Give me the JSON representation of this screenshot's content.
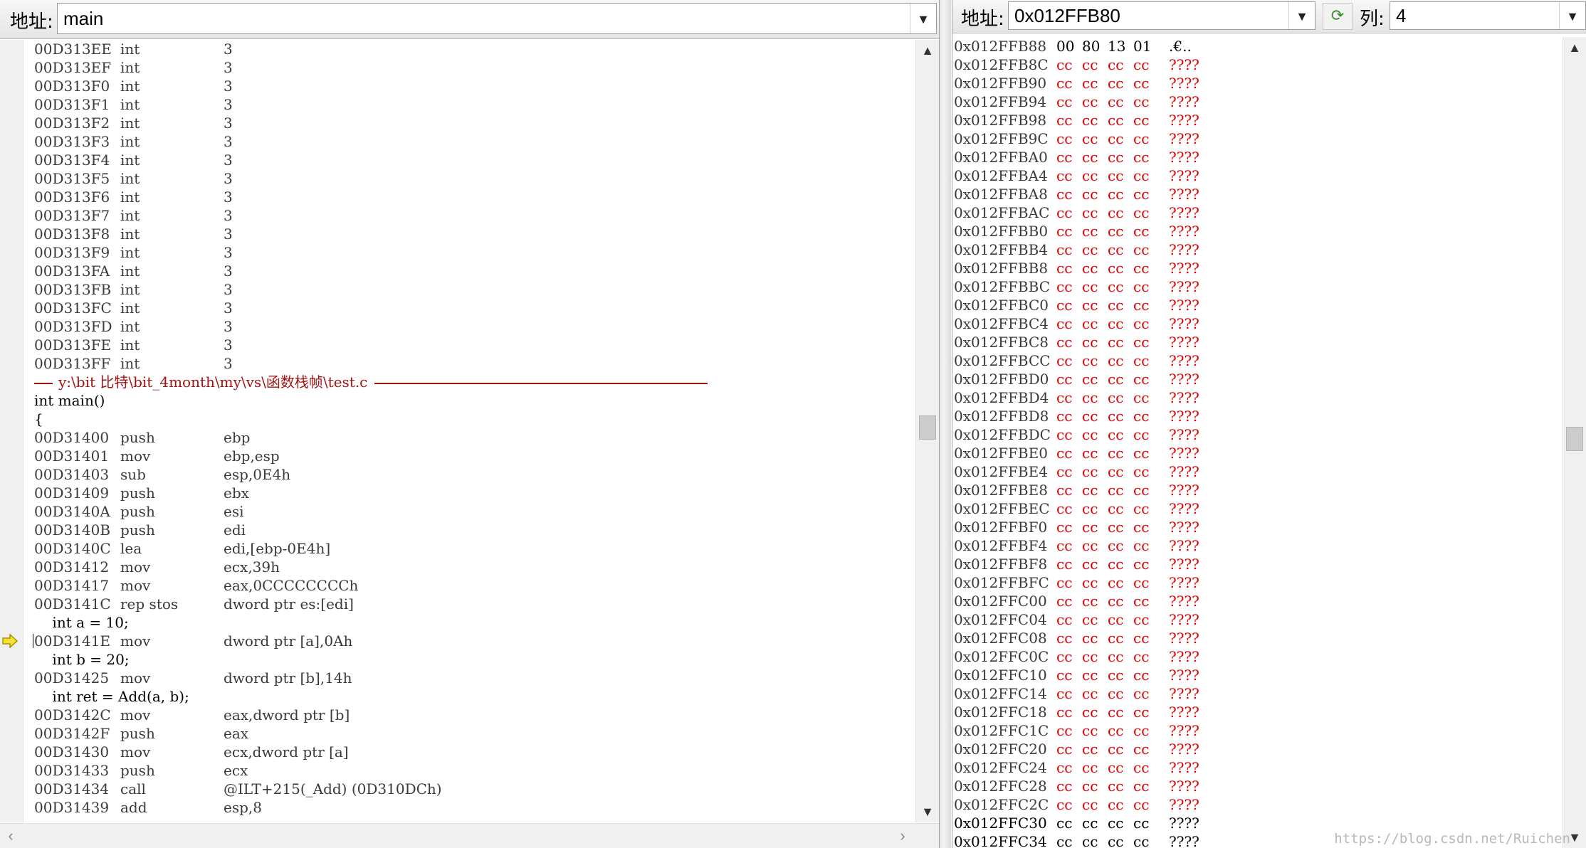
{
  "disasm": {
    "address_label": "地址:",
    "address_value": "main",
    "rows": [
      {
        "kind": "asm",
        "addr": "00D313EE",
        "op": "int",
        "arg": "3"
      },
      {
        "kind": "asm",
        "addr": "00D313EF",
        "op": "int",
        "arg": "3"
      },
      {
        "kind": "asm",
        "addr": "00D313F0",
        "op": "int",
        "arg": "3"
      },
      {
        "kind": "asm",
        "addr": "00D313F1",
        "op": "int",
        "arg": "3"
      },
      {
        "kind": "asm",
        "addr": "00D313F2",
        "op": "int",
        "arg": "3"
      },
      {
        "kind": "asm",
        "addr": "00D313F3",
        "op": "int",
        "arg": "3"
      },
      {
        "kind": "asm",
        "addr": "00D313F4",
        "op": "int",
        "arg": "3"
      },
      {
        "kind": "asm",
        "addr": "00D313F5",
        "op": "int",
        "arg": "3"
      },
      {
        "kind": "asm",
        "addr": "00D313F6",
        "op": "int",
        "arg": "3"
      },
      {
        "kind": "asm",
        "addr": "00D313F7",
        "op": "int",
        "arg": "3"
      },
      {
        "kind": "asm",
        "addr": "00D313F8",
        "op": "int",
        "arg": "3"
      },
      {
        "kind": "asm",
        "addr": "00D313F9",
        "op": "int",
        "arg": "3"
      },
      {
        "kind": "asm",
        "addr": "00D313FA",
        "op": "int",
        "arg": "3"
      },
      {
        "kind": "asm",
        "addr": "00D313FB",
        "op": "int",
        "arg": "3"
      },
      {
        "kind": "asm",
        "addr": "00D313FC",
        "op": "int",
        "arg": "3"
      },
      {
        "kind": "asm",
        "addr": "00D313FD",
        "op": "int",
        "arg": "3"
      },
      {
        "kind": "asm",
        "addr": "00D313FE",
        "op": "int",
        "arg": "3"
      },
      {
        "kind": "asm",
        "addr": "00D313FF",
        "op": "int",
        "arg": "3"
      },
      {
        "kind": "sep",
        "text": "y:\\bit 比特\\bit_4month\\my\\vs\\函数栈帧\\test.c"
      },
      {
        "kind": "src",
        "text": "int main()"
      },
      {
        "kind": "src",
        "text": "{"
      },
      {
        "kind": "asm",
        "addr": "00D31400",
        "op": "push",
        "arg": "ebp"
      },
      {
        "kind": "asm",
        "addr": "00D31401",
        "op": "mov",
        "arg": "ebp,esp"
      },
      {
        "kind": "asm",
        "addr": "00D31403",
        "op": "sub",
        "arg": "esp,0E4h"
      },
      {
        "kind": "asm",
        "addr": "00D31409",
        "op": "push",
        "arg": "ebx"
      },
      {
        "kind": "asm",
        "addr": "00D3140A",
        "op": "push",
        "arg": "esi"
      },
      {
        "kind": "asm",
        "addr": "00D3140B",
        "op": "push",
        "arg": "edi"
      },
      {
        "kind": "asm",
        "addr": "00D3140C",
        "op": "lea",
        "arg": "edi,[ebp-0E4h]"
      },
      {
        "kind": "asm",
        "addr": "00D31412",
        "op": "mov",
        "arg": "ecx,39h"
      },
      {
        "kind": "asm",
        "addr": "00D31417",
        "op": "mov",
        "arg": "eax,0CCCCCCCCh"
      },
      {
        "kind": "asm",
        "addr": "00D3141C",
        "op": "rep stos",
        "arg": "dword ptr es:[edi]"
      },
      {
        "kind": "src",
        "text": "    int a = 10;"
      },
      {
        "kind": "asm",
        "addr": "00D3141E",
        "op": "mov",
        "arg": "dword ptr [a],0Ah",
        "current": true
      },
      {
        "kind": "src",
        "text": "    int b = 20;"
      },
      {
        "kind": "asm",
        "addr": "00D31425",
        "op": "mov",
        "arg": "dword ptr [b],14h"
      },
      {
        "kind": "src",
        "text": "    int ret = Add(a, b);"
      },
      {
        "kind": "asm",
        "addr": "00D3142C",
        "op": "mov",
        "arg": "eax,dword ptr [b]"
      },
      {
        "kind": "asm",
        "addr": "00D3142F",
        "op": "push",
        "arg": "eax"
      },
      {
        "kind": "asm",
        "addr": "00D31430",
        "op": "mov",
        "arg": "ecx,dword ptr [a]"
      },
      {
        "kind": "asm",
        "addr": "00D31433",
        "op": "push",
        "arg": "ecx"
      },
      {
        "kind": "asm",
        "addr": "00D31434",
        "op": "call",
        "arg": "@ILT+215(_Add) (0D310DCh)"
      },
      {
        "kind": "asm",
        "addr": "00D31439",
        "op": "add",
        "arg": "esp,8"
      }
    ]
  },
  "memory": {
    "address_label": "地址:",
    "address_value": "0x012FFB80",
    "columns_label": "列:",
    "columns_value": "4",
    "rows": [
      {
        "addr": "0x012FFB88",
        "bytes": [
          "00",
          "80",
          "13",
          "01"
        ],
        "ascii": ".€.."
      },
      {
        "addr": "0x012FFB8C",
        "bytes": [
          "cc",
          "cc",
          "cc",
          "cc"
        ],
        "ascii": "????"
      },
      {
        "addr": "0x012FFB90",
        "bytes": [
          "cc",
          "cc",
          "cc",
          "cc"
        ],
        "ascii": "????"
      },
      {
        "addr": "0x012FFB94",
        "bytes": [
          "cc",
          "cc",
          "cc",
          "cc"
        ],
        "ascii": "????"
      },
      {
        "addr": "0x012FFB98",
        "bytes": [
          "cc",
          "cc",
          "cc",
          "cc"
        ],
        "ascii": "????"
      },
      {
        "addr": "0x012FFB9C",
        "bytes": [
          "cc",
          "cc",
          "cc",
          "cc"
        ],
        "ascii": "????"
      },
      {
        "addr": "0x012FFBA0",
        "bytes": [
          "cc",
          "cc",
          "cc",
          "cc"
        ],
        "ascii": "????"
      },
      {
        "addr": "0x012FFBA4",
        "bytes": [
          "cc",
          "cc",
          "cc",
          "cc"
        ],
        "ascii": "????"
      },
      {
        "addr": "0x012FFBA8",
        "bytes": [
          "cc",
          "cc",
          "cc",
          "cc"
        ],
        "ascii": "????"
      },
      {
        "addr": "0x012FFBAC",
        "bytes": [
          "cc",
          "cc",
          "cc",
          "cc"
        ],
        "ascii": "????"
      },
      {
        "addr": "0x012FFBB0",
        "bytes": [
          "cc",
          "cc",
          "cc",
          "cc"
        ],
        "ascii": "????"
      },
      {
        "addr": "0x012FFBB4",
        "bytes": [
          "cc",
          "cc",
          "cc",
          "cc"
        ],
        "ascii": "????"
      },
      {
        "addr": "0x012FFBB8",
        "bytes": [
          "cc",
          "cc",
          "cc",
          "cc"
        ],
        "ascii": "????"
      },
      {
        "addr": "0x012FFBBC",
        "bytes": [
          "cc",
          "cc",
          "cc",
          "cc"
        ],
        "ascii": "????"
      },
      {
        "addr": "0x012FFBC0",
        "bytes": [
          "cc",
          "cc",
          "cc",
          "cc"
        ],
        "ascii": "????"
      },
      {
        "addr": "0x012FFBC4",
        "bytes": [
          "cc",
          "cc",
          "cc",
          "cc"
        ],
        "ascii": "????"
      },
      {
        "addr": "0x012FFBC8",
        "bytes": [
          "cc",
          "cc",
          "cc",
          "cc"
        ],
        "ascii": "????"
      },
      {
        "addr": "0x012FFBCC",
        "bytes": [
          "cc",
          "cc",
          "cc",
          "cc"
        ],
        "ascii": "????"
      },
      {
        "addr": "0x012FFBD0",
        "bytes": [
          "cc",
          "cc",
          "cc",
          "cc"
        ],
        "ascii": "????"
      },
      {
        "addr": "0x012FFBD4",
        "bytes": [
          "cc",
          "cc",
          "cc",
          "cc"
        ],
        "ascii": "????"
      },
      {
        "addr": "0x012FFBD8",
        "bytes": [
          "cc",
          "cc",
          "cc",
          "cc"
        ],
        "ascii": "????"
      },
      {
        "addr": "0x012FFBDC",
        "bytes": [
          "cc",
          "cc",
          "cc",
          "cc"
        ],
        "ascii": "????"
      },
      {
        "addr": "0x012FFBE0",
        "bytes": [
          "cc",
          "cc",
          "cc",
          "cc"
        ],
        "ascii": "????"
      },
      {
        "addr": "0x012FFBE4",
        "bytes": [
          "cc",
          "cc",
          "cc",
          "cc"
        ],
        "ascii": "????"
      },
      {
        "addr": "0x012FFBE8",
        "bytes": [
          "cc",
          "cc",
          "cc",
          "cc"
        ],
        "ascii": "????"
      },
      {
        "addr": "0x012FFBEC",
        "bytes": [
          "cc",
          "cc",
          "cc",
          "cc"
        ],
        "ascii": "????"
      },
      {
        "addr": "0x012FFBF0",
        "bytes": [
          "cc",
          "cc",
          "cc",
          "cc"
        ],
        "ascii": "????"
      },
      {
        "addr": "0x012FFBF4",
        "bytes": [
          "cc",
          "cc",
          "cc",
          "cc"
        ],
        "ascii": "????"
      },
      {
        "addr": "0x012FFBF8",
        "bytes": [
          "cc",
          "cc",
          "cc",
          "cc"
        ],
        "ascii": "????"
      },
      {
        "addr": "0x012FFBFC",
        "bytes": [
          "cc",
          "cc",
          "cc",
          "cc"
        ],
        "ascii": "????"
      },
      {
        "addr": "0x012FFC00",
        "bytes": [
          "cc",
          "cc",
          "cc",
          "cc"
        ],
        "ascii": "????"
      },
      {
        "addr": "0x012FFC04",
        "bytes": [
          "cc",
          "cc",
          "cc",
          "cc"
        ],
        "ascii": "????"
      },
      {
        "addr": "0x012FFC08",
        "bytes": [
          "cc",
          "cc",
          "cc",
          "cc"
        ],
        "ascii": "????"
      },
      {
        "addr": "0x012FFC0C",
        "bytes": [
          "cc",
          "cc",
          "cc",
          "cc"
        ],
        "ascii": "????"
      },
      {
        "addr": "0x012FFC10",
        "bytes": [
          "cc",
          "cc",
          "cc",
          "cc"
        ],
        "ascii": "????"
      },
      {
        "addr": "0x012FFC14",
        "bytes": [
          "cc",
          "cc",
          "cc",
          "cc"
        ],
        "ascii": "????"
      },
      {
        "addr": "0x012FFC18",
        "bytes": [
          "cc",
          "cc",
          "cc",
          "cc"
        ],
        "ascii": "????"
      },
      {
        "addr": "0x012FFC1C",
        "bytes": [
          "cc",
          "cc",
          "cc",
          "cc"
        ],
        "ascii": "????"
      },
      {
        "addr": "0x012FFC20",
        "bytes": [
          "cc",
          "cc",
          "cc",
          "cc"
        ],
        "ascii": "????"
      },
      {
        "addr": "0x012FFC24",
        "bytes": [
          "cc",
          "cc",
          "cc",
          "cc"
        ],
        "ascii": "????"
      },
      {
        "addr": "0x012FFC28",
        "bytes": [
          "cc",
          "cc",
          "cc",
          "cc"
        ],
        "ascii": "????"
      },
      {
        "addr": "0x012FFC2C",
        "bytes": [
          "cc",
          "cc",
          "cc",
          "cc"
        ],
        "ascii": "????"
      },
      {
        "addr": "0x012FFC30",
        "bytes": [
          "cc",
          "cc",
          "cc",
          "cc"
        ],
        "ascii": "????"
      },
      {
        "addr": "0x012FFC34",
        "bytes": [
          "cc",
          "cc",
          "cc",
          "cc"
        ],
        "ascii": "????"
      }
    ]
  },
  "watermark": "https://blog.csdn.net/Ruichen",
  "colors": {
    "changed_value": "#e00000",
    "source_separator": "#a31515",
    "current_arrow": "#f5e232"
  }
}
